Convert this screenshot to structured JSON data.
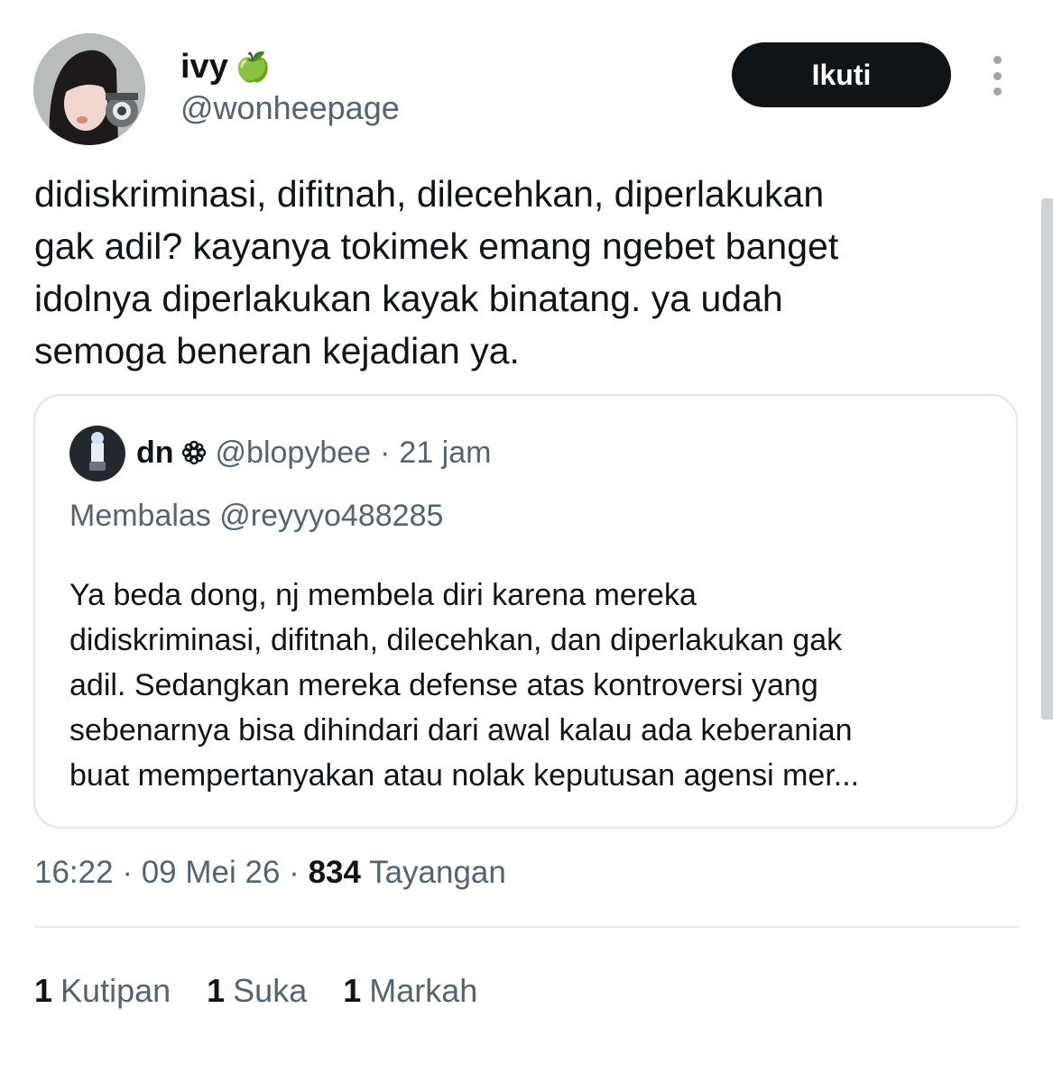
{
  "author": {
    "display_name": "ivy",
    "emoji": "🍏",
    "handle": "@wonheepage"
  },
  "follow_button": {
    "label": "Ikuti"
  },
  "tweet": {
    "text": "didiskriminasi, difitnah, dilecehkan, diperlakukan\ngak adil? kayanya tokimek emang ngebet banget\nidolnya diperlakukan kayak binatang. ya udah\nsemoga beneran kejadian ya."
  },
  "quoted_tweet": {
    "display_name": "dn",
    "handle": "@blopybee",
    "separator": "·",
    "time": "21 jam",
    "replying_to": "Membalas @reyyyo488285",
    "text": "Ya beda dong, nj membela diri karena mereka\ndidiskriminasi, difitnah, dilecehkan, dan diperlakukan gak\nadil. Sedangkan mereka defense atas kontroversi yang\nsebenarnya bisa dihindari dari awal kalau ada keberanian\nbuat mempertanyakan atau nolak keputusan agensi mer..."
  },
  "meta": {
    "time": "16:22",
    "separator": "·",
    "date": "09 Mei 26",
    "views_count": "834",
    "views_label": "Tayangan"
  },
  "stats": [
    {
      "count": "1",
      "label": "Kutipan"
    },
    {
      "count": "1",
      "label": "Suka"
    },
    {
      "count": "1",
      "label": "Markah"
    }
  ],
  "colors": {
    "text_primary": "#0f1419",
    "text_secondary": "#536471",
    "follow_button_bg": "#0f1419",
    "border": "#e1e6ea"
  }
}
